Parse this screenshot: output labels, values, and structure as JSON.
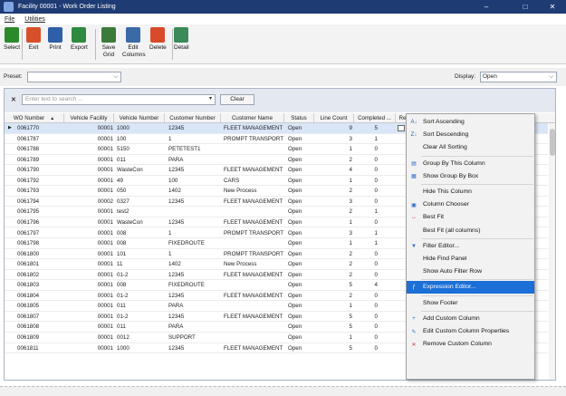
{
  "window": {
    "title": "Facility 00001 - Work Order Listing",
    "min_glyph": "–",
    "max_glyph": "□",
    "close_glyph": "✕"
  },
  "menu": {
    "file": "File",
    "utilities": "Utilities"
  },
  "toolbar": [
    {
      "name": "select",
      "label": "Select",
      "icon": "check-icon",
      "color": "#2a8a2a"
    },
    {
      "name": "exit",
      "label": "Exit",
      "icon": "exit-door-icon",
      "color": "#d8502a"
    },
    {
      "name": "print",
      "label": "Print",
      "icon": "printer-icon",
      "color": "#2f5fa8"
    },
    {
      "name": "export",
      "label": "Export",
      "icon": "export-arrow-icon",
      "color": "#2e8a3e"
    },
    {
      "name": "save-grid",
      "label": "Save Grid",
      "icon": "save-grid-icon",
      "color": "#3a7a3a"
    },
    {
      "name": "edit-columns",
      "label": "Edit Columns",
      "icon": "edit-columns-icon",
      "color": "#3a6aa8"
    },
    {
      "name": "delete",
      "label": "Delete",
      "icon": "trash-icon",
      "color": "#d84a2a"
    },
    {
      "name": "detail",
      "label": "Detail",
      "icon": "detail-document-icon",
      "color": "#3a8a5a"
    }
  ],
  "preset": {
    "label": "Preset:",
    "value": ""
  },
  "display": {
    "label": "Display:",
    "value": "Open"
  },
  "find": {
    "close_glyph": "✕",
    "placeholder": "Enter text to search ...",
    "clear_label": "Clear"
  },
  "columns": [
    {
      "label": "WO Number",
      "sort_glyph": "▲"
    },
    {
      "label": "Vehicle Facility"
    },
    {
      "label": "Vehicle Number"
    },
    {
      "label": "Customer Number"
    },
    {
      "label": "Customer Name"
    },
    {
      "label": "Status"
    },
    {
      "label": "Line Count"
    },
    {
      "label": "Completed ..."
    },
    {
      "label": "Re"
    }
  ],
  "rows": [
    {
      "wo": "0061770",
      "fac": "00001",
      "veh": "1000",
      "cnum": "12345",
      "cname": "FLEET MANAGEMENT",
      "status": "Open",
      "lines": "9",
      "done": "5",
      "selected": true
    },
    {
      "wo": "0061787",
      "fac": "00001",
      "veh": "100",
      "cnum": "1",
      "cname": "PROMPT TRANSPORT",
      "status": "Open",
      "lines": "3",
      "done": "1"
    },
    {
      "wo": "0061788",
      "fac": "00001",
      "veh": "5150",
      "cnum": "PETETEST1",
      "cname": "",
      "status": "Open",
      "lines": "1",
      "done": "0"
    },
    {
      "wo": "0061789",
      "fac": "00001",
      "veh": "011",
      "cnum": "PARA",
      "cname": "",
      "status": "Open",
      "lines": "2",
      "done": "0"
    },
    {
      "wo": "0061790",
      "fac": "00001",
      "veh": "WasteCon",
      "cnum": "12345",
      "cname": "FLEET MANAGEMENT",
      "status": "Open",
      "lines": "4",
      "done": "0"
    },
    {
      "wo": "0061792",
      "fac": "00001",
      "veh": "49",
      "cnum": "100",
      "cname": "CARS",
      "status": "Open",
      "lines": "1",
      "done": "0"
    },
    {
      "wo": "0061793",
      "fac": "00001",
      "veh": "050",
      "cnum": "1402",
      "cname": "New Process",
      "status": "Open",
      "lines": "2",
      "done": "0"
    },
    {
      "wo": "0061794",
      "fac": "00002",
      "veh": "0327",
      "cnum": "12345",
      "cname": "FLEET MANAGEMENT",
      "status": "Open",
      "lines": "3",
      "done": "0"
    },
    {
      "wo": "0061795",
      "fac": "00001",
      "veh": "test2",
      "cnum": "",
      "cname": "",
      "status": "Open",
      "lines": "2",
      "done": "1"
    },
    {
      "wo": "0061796",
      "fac": "00001",
      "veh": "WasteCon",
      "cnum": "12345",
      "cname": "FLEET MANAGEMENT",
      "status": "Open",
      "lines": "1",
      "done": "0"
    },
    {
      "wo": "0061797",
      "fac": "00001",
      "veh": "008",
      "cnum": "1",
      "cname": "PROMPT TRANSPORT",
      "status": "Open",
      "lines": "3",
      "done": "1"
    },
    {
      "wo": "0061798",
      "fac": "00001",
      "veh": "008",
      "cnum": "FIXEDROUTE",
      "cname": "",
      "status": "Open",
      "lines": "1",
      "done": "1"
    },
    {
      "wo": "0061800",
      "fac": "00001",
      "veh": "101",
      "cnum": "1",
      "cname": "PROMPT TRANSPORT",
      "status": "Open",
      "lines": "2",
      "done": "0"
    },
    {
      "wo": "0061801",
      "fac": "00001",
      "veh": "11",
      "cnum": "1402",
      "cname": "New Process",
      "status": "Open",
      "lines": "2",
      "done": "0"
    },
    {
      "wo": "0061802",
      "fac": "00001",
      "veh": "01-2",
      "cnum": "12345",
      "cname": "FLEET MANAGEMENT",
      "status": "Open",
      "lines": "2",
      "done": "0"
    },
    {
      "wo": "0061803",
      "fac": "00001",
      "veh": "008",
      "cnum": "FIXEDROUTE",
      "cname": "",
      "status": "Open",
      "lines": "5",
      "done": "4"
    },
    {
      "wo": "0061804",
      "fac": "00001",
      "veh": "01-2",
      "cnum": "12345",
      "cname": "FLEET MANAGEMENT",
      "status": "Open",
      "lines": "2",
      "done": "0"
    },
    {
      "wo": "0061805",
      "fac": "00001",
      "veh": "011",
      "cnum": "PARA",
      "cname": "",
      "status": "Open",
      "lines": "1",
      "done": "0"
    },
    {
      "wo": "0061807",
      "fac": "00001",
      "veh": "01-2",
      "cnum": "12345",
      "cname": "FLEET MANAGEMENT",
      "status": "Open",
      "lines": "5",
      "done": "0"
    },
    {
      "wo": "0061808",
      "fac": "00001",
      "veh": "011",
      "cnum": "PARA",
      "cname": "",
      "status": "Open",
      "lines": "5",
      "done": "0"
    },
    {
      "wo": "0061809",
      "fac": "00001",
      "veh": "0012",
      "cnum": "SUPPORT",
      "cname": "",
      "status": "Open",
      "lines": "1",
      "done": "0"
    },
    {
      "wo": "0061811",
      "fac": "00001",
      "veh": "1000",
      "cnum": "12345",
      "cname": "FLEET MANAGEMENT",
      "status": "Open",
      "lines": "5",
      "done": "0"
    }
  ],
  "context_menu": [
    {
      "label": "Sort Ascending",
      "icon": "sort-ascending-icon",
      "glyph": "A↓",
      "color": "#1b5fc0"
    },
    {
      "label": "Sort Descending",
      "icon": "sort-descending-icon",
      "glyph": "Z↓",
      "color": "#1b5fc0"
    },
    {
      "label": "Clear All Sorting",
      "icon": "",
      "glyph": "",
      "color": ""
    },
    {
      "sep": true
    },
    {
      "label": "Group By This Column",
      "icon": "group-by-column-icon",
      "glyph": "▤",
      "color": "#2a6bc8"
    },
    {
      "label": "Show Group By Box",
      "icon": "group-by-box-icon",
      "glyph": "▦",
      "color": "#2a6bc8"
    },
    {
      "sep": true
    },
    {
      "label": "Hide This Column",
      "icon": "",
      "glyph": "",
      "color": ""
    },
    {
      "label": "Column Chooser",
      "icon": "column-chooser-icon",
      "glyph": "▣",
      "color": "#2a6bc8"
    },
    {
      "label": "Best Fit",
      "icon": "best-fit-icon",
      "glyph": "↔",
      "color": "#d03030"
    },
    {
      "label": "Best Fit (all columns)",
      "icon": "",
      "glyph": "",
      "color": ""
    },
    {
      "sep": true
    },
    {
      "label": "Filter Editor...",
      "icon": "filter-icon",
      "glyph": "▼",
      "color": "#2a6bc8"
    },
    {
      "label": "Hide Find Panel",
      "icon": "",
      "glyph": "",
      "color": ""
    },
    {
      "label": "Show Auto Filter Row",
      "icon": "",
      "glyph": "",
      "color": ""
    },
    {
      "sep": true
    },
    {
      "label": "Expression Editor...",
      "icon": "expression-editor-icon",
      "glyph": "ƒ",
      "color": "#ffffff",
      "highlight": true
    },
    {
      "sep": true
    },
    {
      "label": "Show Footer",
      "icon": "",
      "glyph": "",
      "color": ""
    },
    {
      "sep": true
    },
    {
      "label": "Add Custom Column",
      "icon": "add-column-icon",
      "glyph": "+",
      "color": "#2a6bc8"
    },
    {
      "label": "Edit Custom Column Properties",
      "icon": "edit-column-icon",
      "glyph": "✎",
      "color": "#2a6bc8"
    },
    {
      "label": "Remove Custom Column",
      "icon": "remove-column-icon",
      "glyph": "✕",
      "color": "#d03030"
    }
  ]
}
